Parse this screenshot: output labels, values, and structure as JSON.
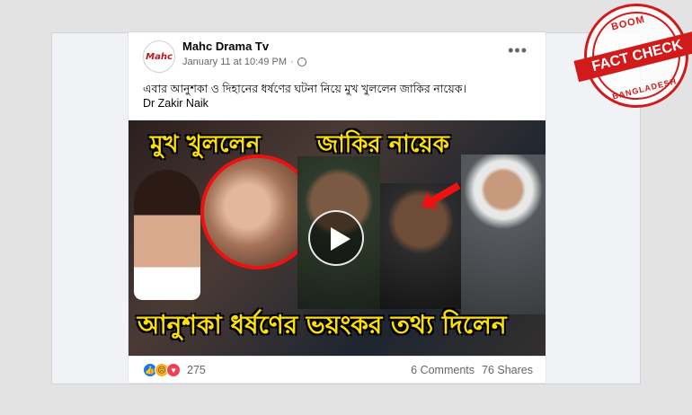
{
  "post": {
    "page_name": "Mahc Drama Tv",
    "avatar_text": "Mahc",
    "timestamp": "January 11 at 10:49 PM",
    "separator": "·",
    "text_line1": "এবার আনুশকা ও দিহানের ধর্ষণের ঘটনা নিয়ে মুখ খুললেন জাকির নায়েক।",
    "text_line2": "Dr Zakir Naik",
    "more_label": "•••"
  },
  "thumbnail": {
    "headline_top_left": "মুখ খুললেন",
    "headline_top_right": "জাকির নায়েক",
    "headline_bottom": "আনুশকা ধর্ষণের ভয়ংকর তথ্য দিলেন"
  },
  "footer": {
    "reaction_count": "275",
    "comments": "6 Comments",
    "shares": "76 Shares",
    "reactions": [
      "like",
      "sad",
      "love"
    ]
  },
  "stamp": {
    "top": "BOOM",
    "middle": "FACT CHECK",
    "bottom": "BANGLADESH"
  },
  "colors": {
    "headline": "#ffe100",
    "stamp": "#d11a1a",
    "like": "#1877f2",
    "love": "#f33e58",
    "sad": "#f7b125"
  }
}
